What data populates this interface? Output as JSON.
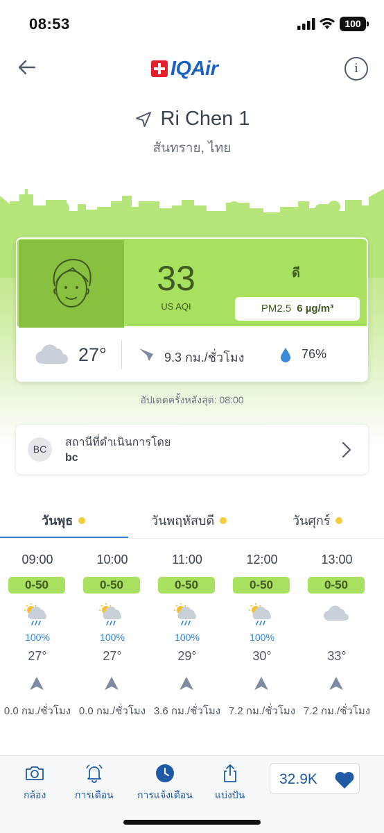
{
  "status_bar": {
    "time": "08:53",
    "battery": "100"
  },
  "header": {
    "logo_text": "IQAir",
    "info_label": "i"
  },
  "location": {
    "name": "Ri Chen 1",
    "subtitle": "สันทราย, ไทย"
  },
  "aqi": {
    "value": "33",
    "unit": "US AQI",
    "status": "ดี",
    "pollutant": "PM2.5",
    "pollutant_value": "6 µg/m³",
    "color": "#a8e05f",
    "face_color": "#87c13f"
  },
  "weather": {
    "temperature": "27°",
    "wind": "9.3 กม./ชั่วโมง",
    "humidity": "76%"
  },
  "updated": "อัปเดตครั้งหลังสุด: 08:00",
  "operator": {
    "avatar": "BC",
    "label": "สถานีที่ดำเนินการโดย",
    "name": "bc"
  },
  "forecast_tabs": [
    {
      "label": "วันพุธ",
      "active": true
    },
    {
      "label": "วันพฤหัสบดี",
      "active": false
    },
    {
      "label": "วันศุกร์",
      "active": false
    }
  ],
  "hourly": [
    {
      "time": "09:00",
      "aqi": "0-50",
      "icon": "partly-cloudy-rain-icon",
      "rain": "100%",
      "temp": "27°",
      "wind": "0.0 กม./ชั่วโมง"
    },
    {
      "time": "10:00",
      "aqi": "0-50",
      "icon": "partly-cloudy-rain-icon",
      "rain": "100%",
      "temp": "27°",
      "wind": "0.0 กม./ชั่วโมง"
    },
    {
      "time": "11:00",
      "aqi": "0-50",
      "icon": "partly-cloudy-rain-icon",
      "rain": "100%",
      "temp": "29°",
      "wind": "3.6 กม./ชั่วโมง"
    },
    {
      "time": "12:00",
      "aqi": "0-50",
      "icon": "partly-cloudy-rain-icon",
      "rain": "100%",
      "temp": "30°",
      "wind": "7.2 กม./ชั่วโมง"
    },
    {
      "time": "13:00",
      "aqi": "0-50",
      "icon": "cloud-icon",
      "rain": "",
      "temp": "33°",
      "wind": "7.2 กม./ชั่วโมง"
    }
  ],
  "bottom_nav": {
    "camera": "กล้อง",
    "alerts": "การเตือน",
    "notifications": "การแจ้งเตือน",
    "share": "แบ่งปัน",
    "likes": "32.9K"
  }
}
